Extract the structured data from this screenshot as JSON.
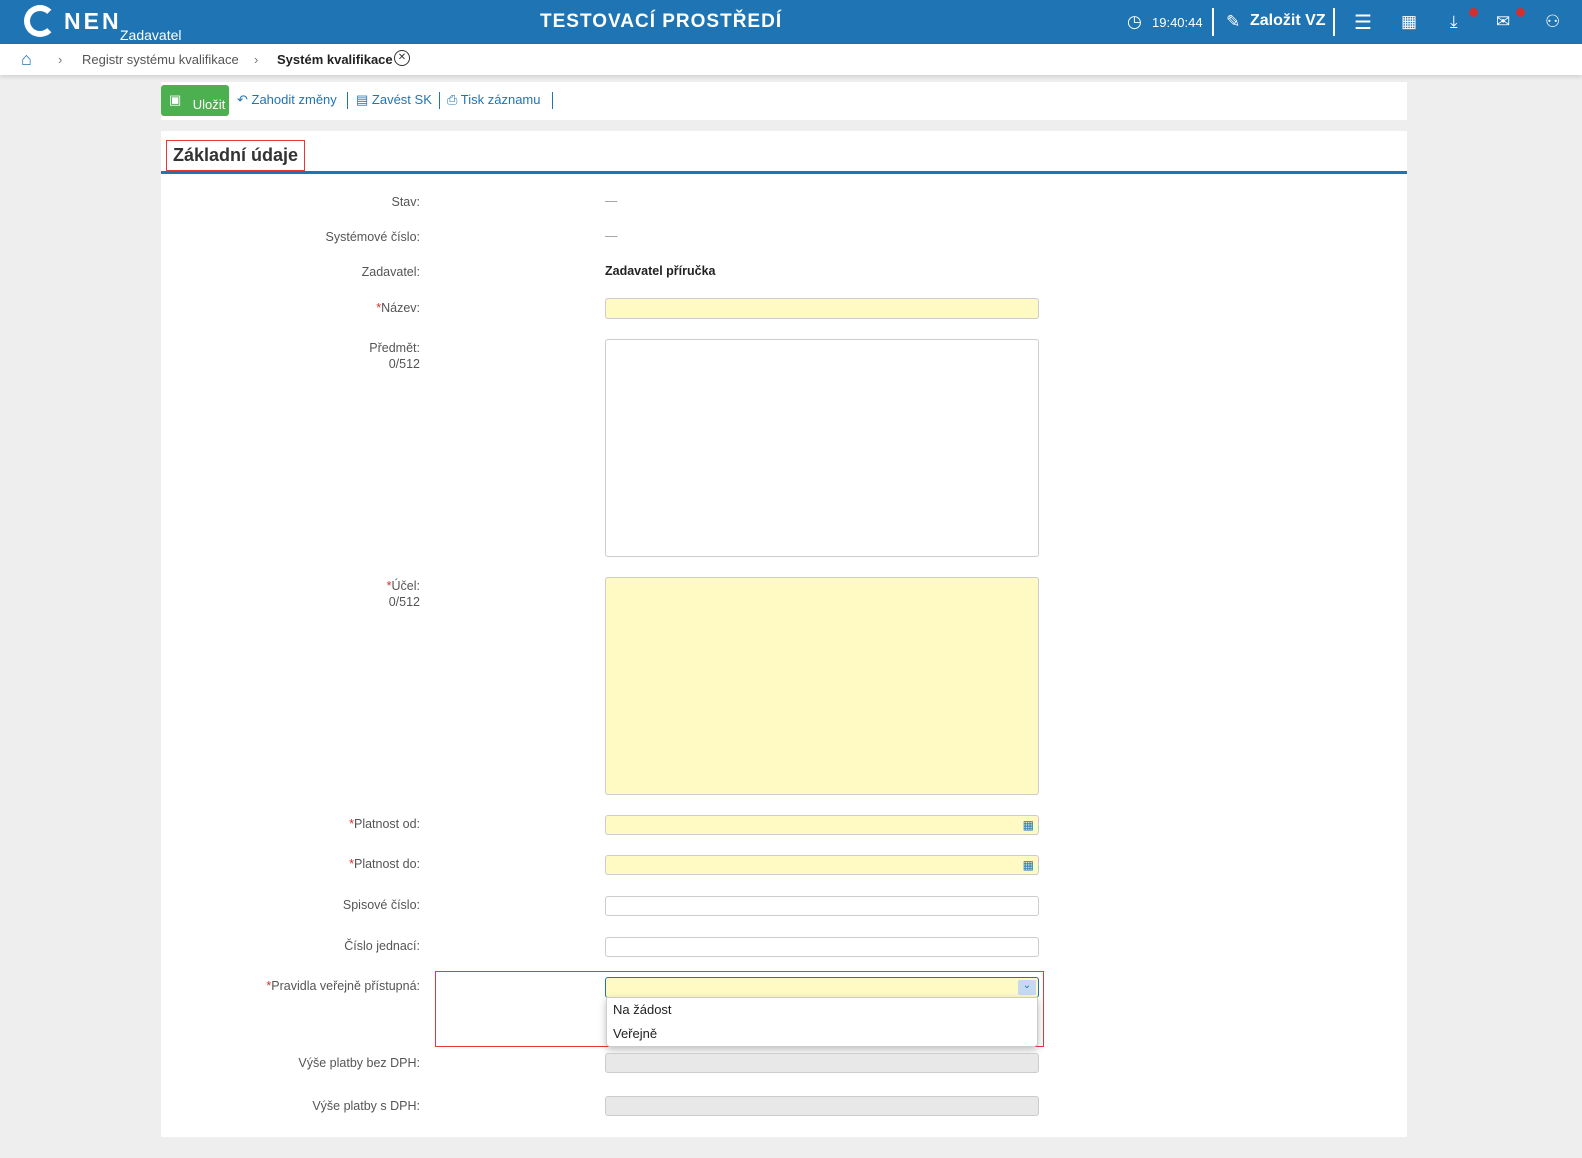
{
  "header": {
    "logo": "NEN",
    "role": "Zadavatel",
    "environment": "TESTOVACÍ PROSTŘEDÍ",
    "time": "19:40:44",
    "create_label": "Založit VZ"
  },
  "breadcrumb": [
    "Registr systému kvalifikace",
    "Systém kvalifikace"
  ],
  "toolbar": {
    "save": "Uložit",
    "discard": "Zahodit změny",
    "create_sk": "Zavést SK",
    "print": "Tisk záznamu"
  },
  "section": "Základní údaje",
  "form": {
    "stav": {
      "label": "Stav:",
      "value": "—"
    },
    "system_no": {
      "label": "Systémové číslo:",
      "value": "—"
    },
    "zadavatel": {
      "label": "Zadavatel:",
      "value": "Zadavatel příručka"
    },
    "nazev": {
      "label": "Název:",
      "value": ""
    },
    "predmet": {
      "label": "Předmět:",
      "counter": "0/512"
    },
    "ucel": {
      "label": "Účel:",
      "counter": "0/512"
    },
    "platnost_od": {
      "label": "Platnost od:"
    },
    "platnost_do": {
      "label": "Platnost do:"
    },
    "spisove": {
      "label": "Spisové číslo:"
    },
    "jednaci": {
      "label": "Číslo jednací:"
    },
    "pravidla": {
      "label": "Pravidla veřejně přístupná:",
      "options": [
        "Na žádost",
        "Veřejně"
      ]
    },
    "bez_dph": {
      "label": "Výše platby bez DPH:"
    },
    "s_dph": {
      "label": "Výše platby s DPH:"
    }
  },
  "required_mark": "*"
}
